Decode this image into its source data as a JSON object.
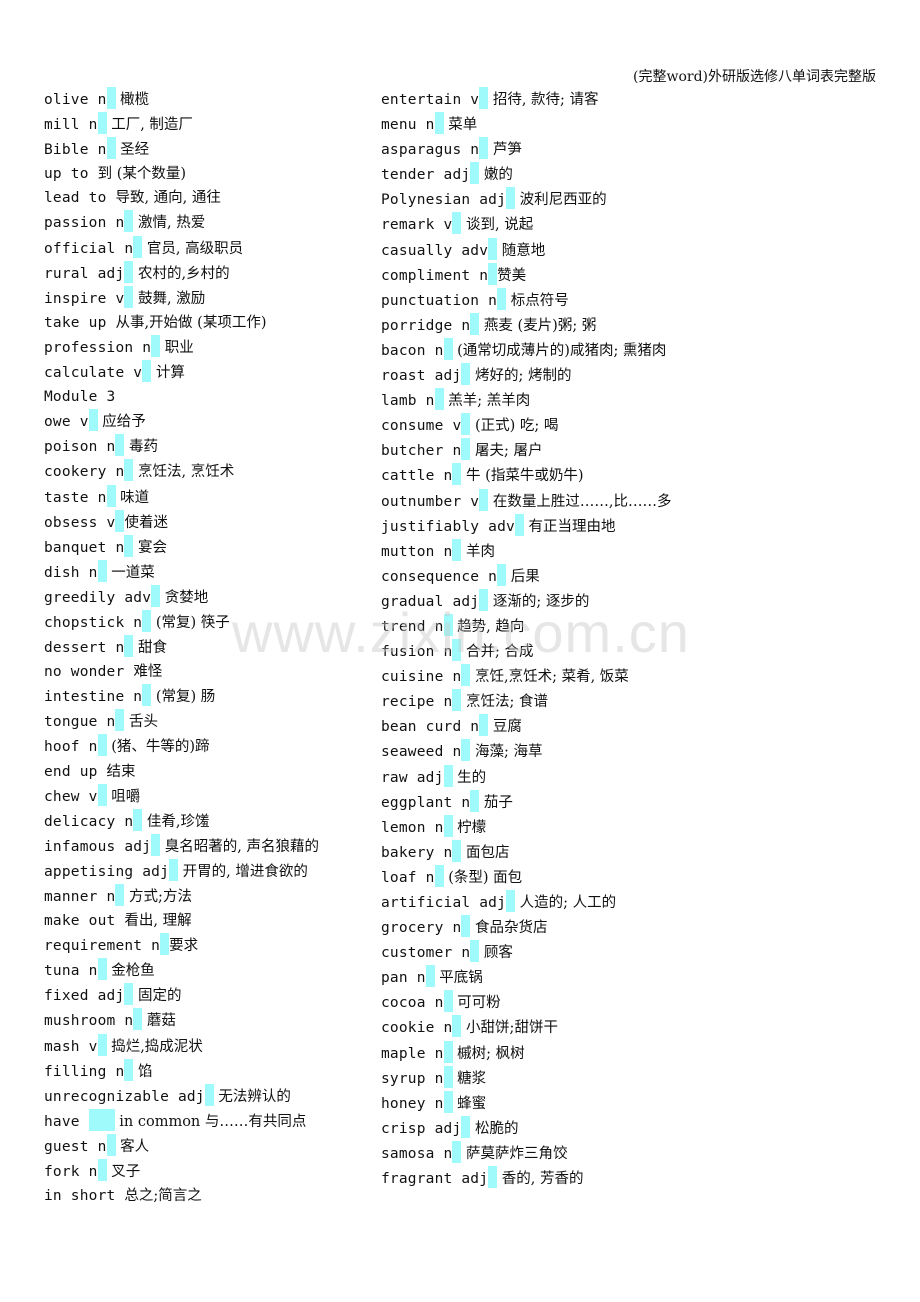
{
  "header": {
    "title": "(完整word)外研版选修八单词表完整版"
  },
  "watermark": "www.zixin.com.cn",
  "highlight_color": "#9ffbfb",
  "left_column": [
    {
      "word": "olive n",
      "hl": true,
      "def": " 橄榄"
    },
    {
      "word": "mill n",
      "hl": true,
      "def": " 工厂, 制造厂"
    },
    {
      "word": "Bible n",
      "hl": true,
      "def": " 圣经"
    },
    {
      "word": "up to ",
      "hl": false,
      "def": "到 (某个数量)"
    },
    {
      "word": "lead to ",
      "hl": false,
      "def": "导致, 通向, 通往"
    },
    {
      "word": "passion n",
      "hl": true,
      "def": " 激情, 热爱"
    },
    {
      "word": "official n",
      "hl": true,
      "def": " 官员, 高级职员"
    },
    {
      "word": "rural adj",
      "hl": true,
      "def": " 农村的,乡村的"
    },
    {
      "word": "inspire v",
      "hl": true,
      "def": " 鼓舞, 激励"
    },
    {
      "word": "take up ",
      "hl": false,
      "def": "从事,开始做 (某项工作)"
    },
    {
      "word": "profession n",
      "hl": true,
      "def": " 职业"
    },
    {
      "word": "calculate v",
      "hl": true,
      "def": " 计算"
    },
    {
      "word": "Module 3",
      "hl": false,
      "def": ""
    },
    {
      "word": "owe v",
      "hl": true,
      "def": " 应给予"
    },
    {
      "word": "poison n",
      "hl": true,
      "def": " 毒药"
    },
    {
      "word": "cookery n",
      "hl": true,
      "def": " 烹饪法, 烹饪术"
    },
    {
      "word": "taste n",
      "hl": true,
      "def": " 味道"
    },
    {
      "word": "obsess v",
      "hl": true,
      "def": "使着迷"
    },
    {
      "word": "banquet n",
      "hl": true,
      "def": " 宴会"
    },
    {
      "word": "dish n",
      "hl": true,
      "def": " 一道菜"
    },
    {
      "word": "greedily adv",
      "hl": true,
      "def": " 贪婪地"
    },
    {
      "word": "chopstick n",
      "hl": true,
      "def": " (常复) 筷子"
    },
    {
      "word": "dessert n",
      "hl": true,
      "def": " 甜食"
    },
    {
      "word": "no wonder ",
      "hl": false,
      "def": "难怪"
    },
    {
      "word": "intestine n",
      "hl": true,
      "def": " (常复) 肠"
    },
    {
      "word": "tongue n",
      "hl": true,
      "def": " 舌头"
    },
    {
      "word": "hoof n",
      "hl": true,
      "def": " (猪、牛等的)蹄"
    },
    {
      "word": "end up ",
      "hl": false,
      "def": "结束"
    },
    {
      "word": "chew v",
      "hl": true,
      "def": " 咀嚼"
    },
    {
      "word": "delicacy n",
      "hl": true,
      "def": " 佳肴,珍馐"
    },
    {
      "word": "infamous adj",
      "hl": true,
      "def": " 臭名昭著的, 声名狼藉的"
    },
    {
      "word": "appetising adj",
      "hl": true,
      "def": " 开胃的, 增进食欲的"
    },
    {
      "word": "manner n",
      "hl": true,
      "def": " 方式;方法"
    },
    {
      "word": "make out ",
      "hl": false,
      "def": "看出, 理解"
    },
    {
      "word": "requirement n",
      "hl": true,
      "def": "要求"
    },
    {
      "word": "tuna n",
      "hl": true,
      "def": " 金枪鱼"
    },
    {
      "word": "fixed adj",
      "hl": true,
      "def": " 固定的"
    },
    {
      "word": "mushroom n",
      "hl": true,
      "def": " 蘑菇"
    },
    {
      "word": "mash v",
      "hl": true,
      "def": " 捣烂,捣成泥状"
    },
    {
      "word": "filling n",
      "hl": true,
      "def": " 馅"
    },
    {
      "word": "unrecognizable adj",
      "hl": true,
      "def": " 无法辨认的"
    },
    {
      "word": "have ",
      "hl": "wide",
      "def": " in common 与……有共同点"
    },
    {
      "word": "guest n",
      "hl": true,
      "def": " 客人"
    },
    {
      "word": "fork n",
      "hl": true,
      "def": " 叉子"
    },
    {
      "word": "in short ",
      "hl": false,
      "def": "总之;简言之"
    }
  ],
  "right_column": [
    {
      "word": "entertain v",
      "hl": true,
      "def": " 招待, 款待; 请客"
    },
    {
      "word": "menu n",
      "hl": true,
      "def": " 菜单"
    },
    {
      "word": "asparagus n",
      "hl": true,
      "def": " 芦笋"
    },
    {
      "word": "tender adj",
      "hl": true,
      "def": " 嫩的"
    },
    {
      "word": "Polynesian adj",
      "hl": true,
      "def": " 波利尼西亚的"
    },
    {
      "word": "remark v",
      "hl": true,
      "def": " 谈到, 说起"
    },
    {
      "word": "casually adv",
      "hl": true,
      "def": " 随意地"
    },
    {
      "word": "compliment n",
      "hl": true,
      "def": "赞美"
    },
    {
      "word": "punctuation n",
      "hl": true,
      "def": " 标点符号"
    },
    {
      "word": "porridge n",
      "hl": true,
      "def": " 燕麦 (麦片)粥; 粥"
    },
    {
      "word": "bacon n",
      "hl": true,
      "def": " (通常切成薄片的)咸猪肉; 熏猪肉"
    },
    {
      "word": "roast adj",
      "hl": true,
      "def": " 烤好的; 烤制的"
    },
    {
      "word": "lamb n",
      "hl": true,
      "def": " 羔羊; 羔羊肉"
    },
    {
      "word": "consume v",
      "hl": true,
      "def": " (正式) 吃; 喝"
    },
    {
      "word": "butcher n",
      "hl": true,
      "def": " 屠夫; 屠户"
    },
    {
      "word": "cattle n",
      "hl": true,
      "def": " 牛 (指菜牛或奶牛)"
    },
    {
      "word": "outnumber v",
      "hl": true,
      "def": " 在数量上胜过……,比……多"
    },
    {
      "word": "justifiably adv",
      "hl": true,
      "def": " 有正当理由地"
    },
    {
      "word": "mutton n",
      "hl": true,
      "def": " 羊肉"
    },
    {
      "word": "consequence n",
      "hl": true,
      "def": " 后果"
    },
    {
      "word": "gradual adj",
      "hl": true,
      "def": " 逐渐的; 逐步的"
    },
    {
      "word": "trend n",
      "hl": true,
      "def": " 趋势, 趋向"
    },
    {
      "word": "fusion n",
      "hl": true,
      "def": " 合并; 合成"
    },
    {
      "word": "cuisine n",
      "hl": true,
      "def": " 烹饪,烹饪术;  菜肴, 饭菜"
    },
    {
      "word": "recipe n",
      "hl": true,
      "def": " 烹饪法; 食谱"
    },
    {
      "word": "bean curd n",
      "hl": true,
      "def": " 豆腐"
    },
    {
      "word": "seaweed n",
      "hl": true,
      "def": " 海藻; 海草"
    },
    {
      "word": "raw adj",
      "hl": true,
      "def": " 生的"
    },
    {
      "word": "eggplant n",
      "hl": true,
      "def": " 茄子"
    },
    {
      "word": "lemon n",
      "hl": true,
      "def": " 柠檬"
    },
    {
      "word": "bakery n",
      "hl": true,
      "def": " 面包店"
    },
    {
      "word": "loaf n",
      "hl": true,
      "def": " (条型) 面包"
    },
    {
      "word": "artificial adj",
      "hl": true,
      "def": " 人造的; 人工的"
    },
    {
      "word": "grocery n",
      "hl": true,
      "def": " 食品杂货店"
    },
    {
      "word": "customer n",
      "hl": true,
      "def": " 顾客"
    },
    {
      "word": "pan n",
      "hl": true,
      "def": " 平底锅"
    },
    {
      "word": "cocoa n",
      "hl": true,
      "def": " 可可粉"
    },
    {
      "word": "cookie n",
      "hl": true,
      "def": " 小甜饼;甜饼干"
    },
    {
      "word": "maple n",
      "hl": true,
      "def": " 槭树; 枫树"
    },
    {
      "word": "syrup n",
      "hl": true,
      "def": " 糖浆"
    },
    {
      "word": "honey n",
      "hl": true,
      "def": " 蜂蜜"
    },
    {
      "word": "crisp adj",
      "hl": true,
      "def": " 松脆的"
    },
    {
      "word": "samosa n",
      "hl": true,
      "def": " 萨莫萨炸三角饺"
    },
    {
      "word": "fragrant adj",
      "hl": true,
      "def": " 香的, 芳香的"
    }
  ]
}
